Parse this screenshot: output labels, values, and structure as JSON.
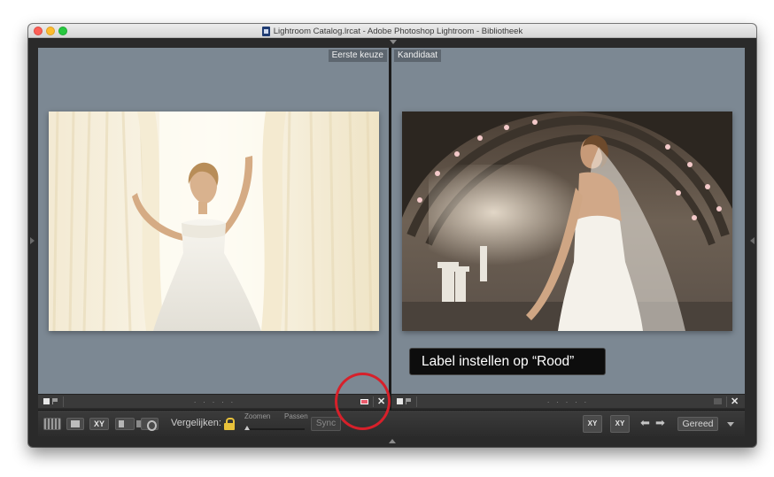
{
  "window": {
    "title": "Lightroom Catalog.lrcat - Adobe Photoshop Lightroom - Bibliotheek"
  },
  "panes": {
    "select_label": "Eerste keuze",
    "candidate_label": "Kandidaat"
  },
  "strip": {
    "left_stars": ". . . . .",
    "right_stars": ". . . . .",
    "close_glyph": "✕"
  },
  "callout": {
    "text": "Label instellen op “Rood”"
  },
  "toolbar": {
    "xy_label": "XY",
    "compare_label": "Vergelijken:",
    "zoom_label": "Zoomen",
    "fit_label": "Passen",
    "sync_label": "Sync",
    "swap_label": "XY",
    "make_select_label": "XY",
    "prev_arrow": "⬅",
    "next_arrow": "➡",
    "done_label": "Gereed"
  },
  "colors": {
    "pane_background": "#7c8893",
    "label_red": "#e95a6b",
    "callout_circle": "#d7202a"
  },
  "icons": [
    "grid-view-icon",
    "loupe-view-icon",
    "compare-view-icon",
    "survey-view-icon",
    "people-view-icon",
    "lock-icon",
    "flag-icon",
    "reject-flag-icon",
    "swap-icon",
    "make-select-icon",
    "previous-arrow-icon",
    "next-arrow-icon",
    "filmstrip-toggle-icon"
  ]
}
